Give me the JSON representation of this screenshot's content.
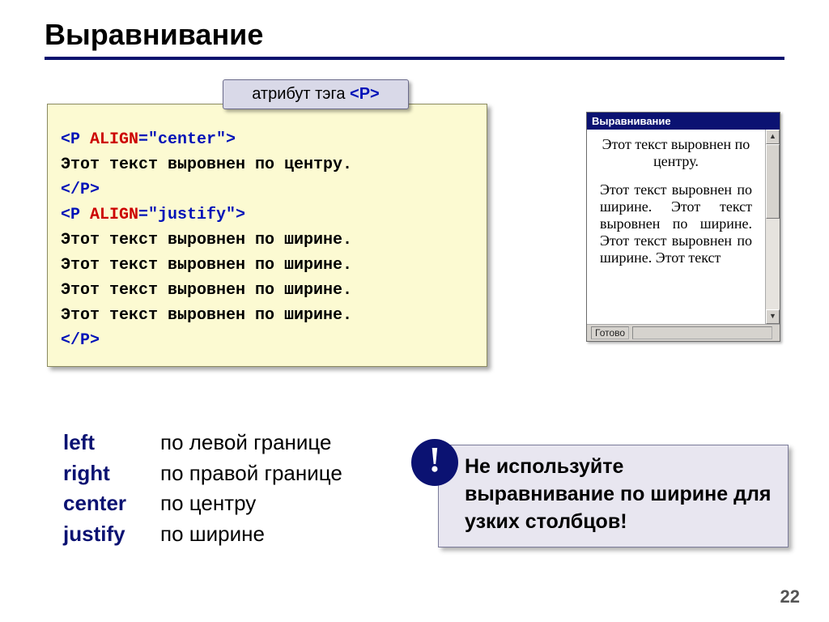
{
  "title": "Выравнивание",
  "attr_label_pre": "атрибут тэга ",
  "attr_label_tag": "<P>",
  "code": {
    "l1_open": "<P ",
    "l1_attr": "ALIGN",
    "l1_eq": "=\"center\">",
    "l2": "Этот текст выровнен по центру.",
    "l3": "</P>",
    "l4_open": "<P ",
    "l4_attr": "ALIGN",
    "l4_eq": "=\"justify\">",
    "l5": "Этот текст выровнен по ширине.",
    "l6": "Этот текст выровнен по ширине.",
    "l7": "Этот текст выровнен по ширине.",
    "l8": "Этот текст выровнен по ширине.",
    "l9": "</P>"
  },
  "preview": {
    "title": "Выравнивание",
    "center_text": "Этот текст выровнен по центру.",
    "justify_text": "Этот текст выровнен по ширине. Этот текст выровнен по ширине. Этот текст выровнен по ширине. Этот текст",
    "status": "Готово"
  },
  "align": {
    "left_kw": "left",
    "left_desc": "по левой границе",
    "right_kw": "right",
    "right_desc": "по правой границе",
    "center_kw": "center",
    "center_desc": "по центру",
    "justify_kw": "justify",
    "justify_desc": "по ширине"
  },
  "warning_mark": "!",
  "warning_text": "Не используйте выравнивание по ширине для узких столбцов!",
  "page_number": "22"
}
